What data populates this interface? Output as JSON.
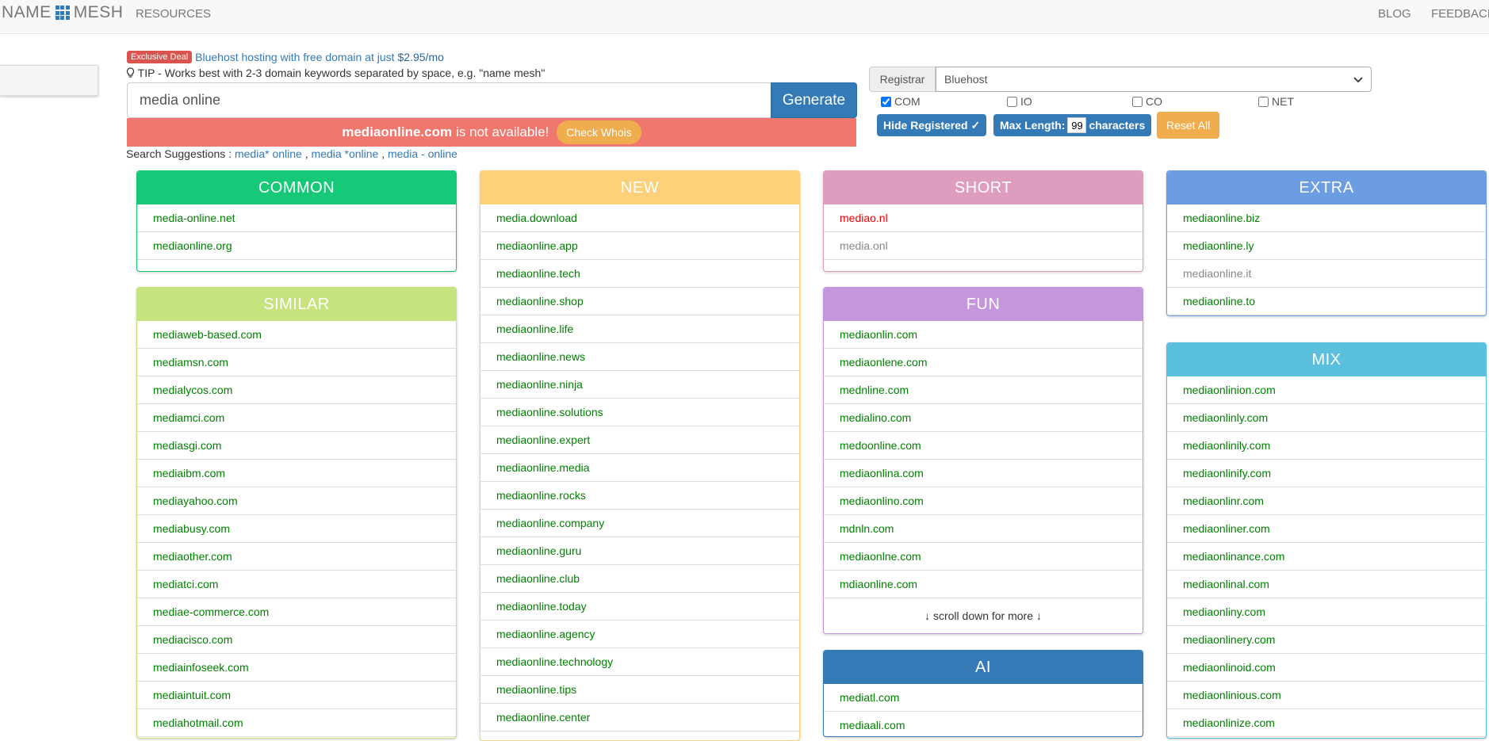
{
  "nav": {
    "brand_left": "NAME",
    "brand_right": "MESH",
    "resources": "RESOURCES",
    "blog": "BLOG",
    "feedback": "FEEDBACK"
  },
  "deal": {
    "badge": "Exclusive Deal",
    "text": "Bluehost hosting with free domain at just",
    "price": "$2.95/mo"
  },
  "tip": {
    "prefix": "TIP -",
    "text": "Works best with 2-3 domain keywords separated by",
    "space": "space",
    "example": ", e.g. \"name mesh\""
  },
  "search": {
    "value": "media online",
    "button": "Generate"
  },
  "alert": {
    "domain": "mediaonline.com",
    "text": "is not available!",
    "button": "Check Whois"
  },
  "suggestions": {
    "label": "Search Suggestions :",
    "items": [
      "media* online",
      "media *online",
      "media - online"
    ]
  },
  "registrar": {
    "label": "Registrar",
    "selected": "Bluehost"
  },
  "tlds": [
    {
      "label": "COM",
      "checked": true
    },
    {
      "label": "IO",
      "checked": false
    },
    {
      "label": "CO",
      "checked": false
    },
    {
      "label": "NET",
      "checked": false
    }
  ],
  "options": {
    "hide_registered": "Hide Registered",
    "check_mark": "✓",
    "max_length_label": "Max Length:",
    "max_length_value": "99",
    "max_length_suffix": "characters",
    "reset": "Reset All"
  },
  "colors": {
    "common": "#15c978",
    "new": "#fdd17a",
    "short": "#de9dbf",
    "extra": "#6c9de3",
    "similar": "#c5e47e",
    "fun": "#c596de",
    "mix": "#5bc0de",
    "ai": "#337ab7"
  },
  "panels": {
    "common": {
      "title": "COMMON",
      "items": [
        "media-online.net",
        "mediaonline.org"
      ]
    },
    "similar": {
      "title": "SIMILAR",
      "items": [
        "mediaweb-based.com",
        "mediamsn.com",
        "medialycos.com",
        "mediamci.com",
        "mediasgi.com",
        "mediaibm.com",
        "mediayahoo.com",
        "mediabusy.com",
        "mediaother.com",
        "mediatci.com",
        "mediae-commerce.com",
        "mediacisco.com",
        "mediainfoseek.com",
        "mediaintuit.com",
        "mediahotmail.com"
      ]
    },
    "new": {
      "title": "NEW",
      "items": [
        "media.download",
        "mediaonline.app",
        "mediaonline.tech",
        "mediaonline.shop",
        "mediaonline.life",
        "mediaonline.news",
        "mediaonline.ninja",
        "mediaonline.solutions",
        "mediaonline.expert",
        "mediaonline.media",
        "mediaonline.rocks",
        "mediaonline.company",
        "mediaonline.guru",
        "mediaonline.club",
        "mediaonline.today",
        "mediaonline.agency",
        "mediaonline.technology",
        "mediaonline.tips",
        "mediaonline.center"
      ]
    },
    "short": {
      "title": "SHORT",
      "items": [
        "mediao.nl",
        "media.onl"
      ]
    },
    "fun": {
      "title": "FUN",
      "items": [
        "mediaonlin.com",
        "mediaonlene.com",
        "mednline.com",
        "medialino.com",
        "medoonline.com",
        "mediaonlina.com",
        "mediaonlino.com",
        "mdnln.com",
        "mediaonlne.com",
        "mdiaonline.com"
      ],
      "footer": "↓ scroll down for more ↓"
    },
    "ai": {
      "title": "AI",
      "items": [
        "mediatl.com",
        "mediaali.com"
      ]
    },
    "extra": {
      "title": "EXTRA",
      "items": [
        "mediaonline.biz",
        "mediaonline.ly",
        "mediaonline.it",
        "mediaonline.to"
      ]
    },
    "mix": {
      "title": "MIX",
      "items": [
        "mediaonlinion.com",
        "mediaonlinly.com",
        "mediaonlinily.com",
        "mediaonlinify.com",
        "mediaonlinr.com",
        "mediaonliner.com",
        "mediaonlinance.com",
        "mediaonlinal.com",
        "mediaonliny.com",
        "mediaonlinery.com",
        "mediaonlinoid.com",
        "mediaonlinious.com",
        "mediaonlinize.com"
      ]
    }
  }
}
